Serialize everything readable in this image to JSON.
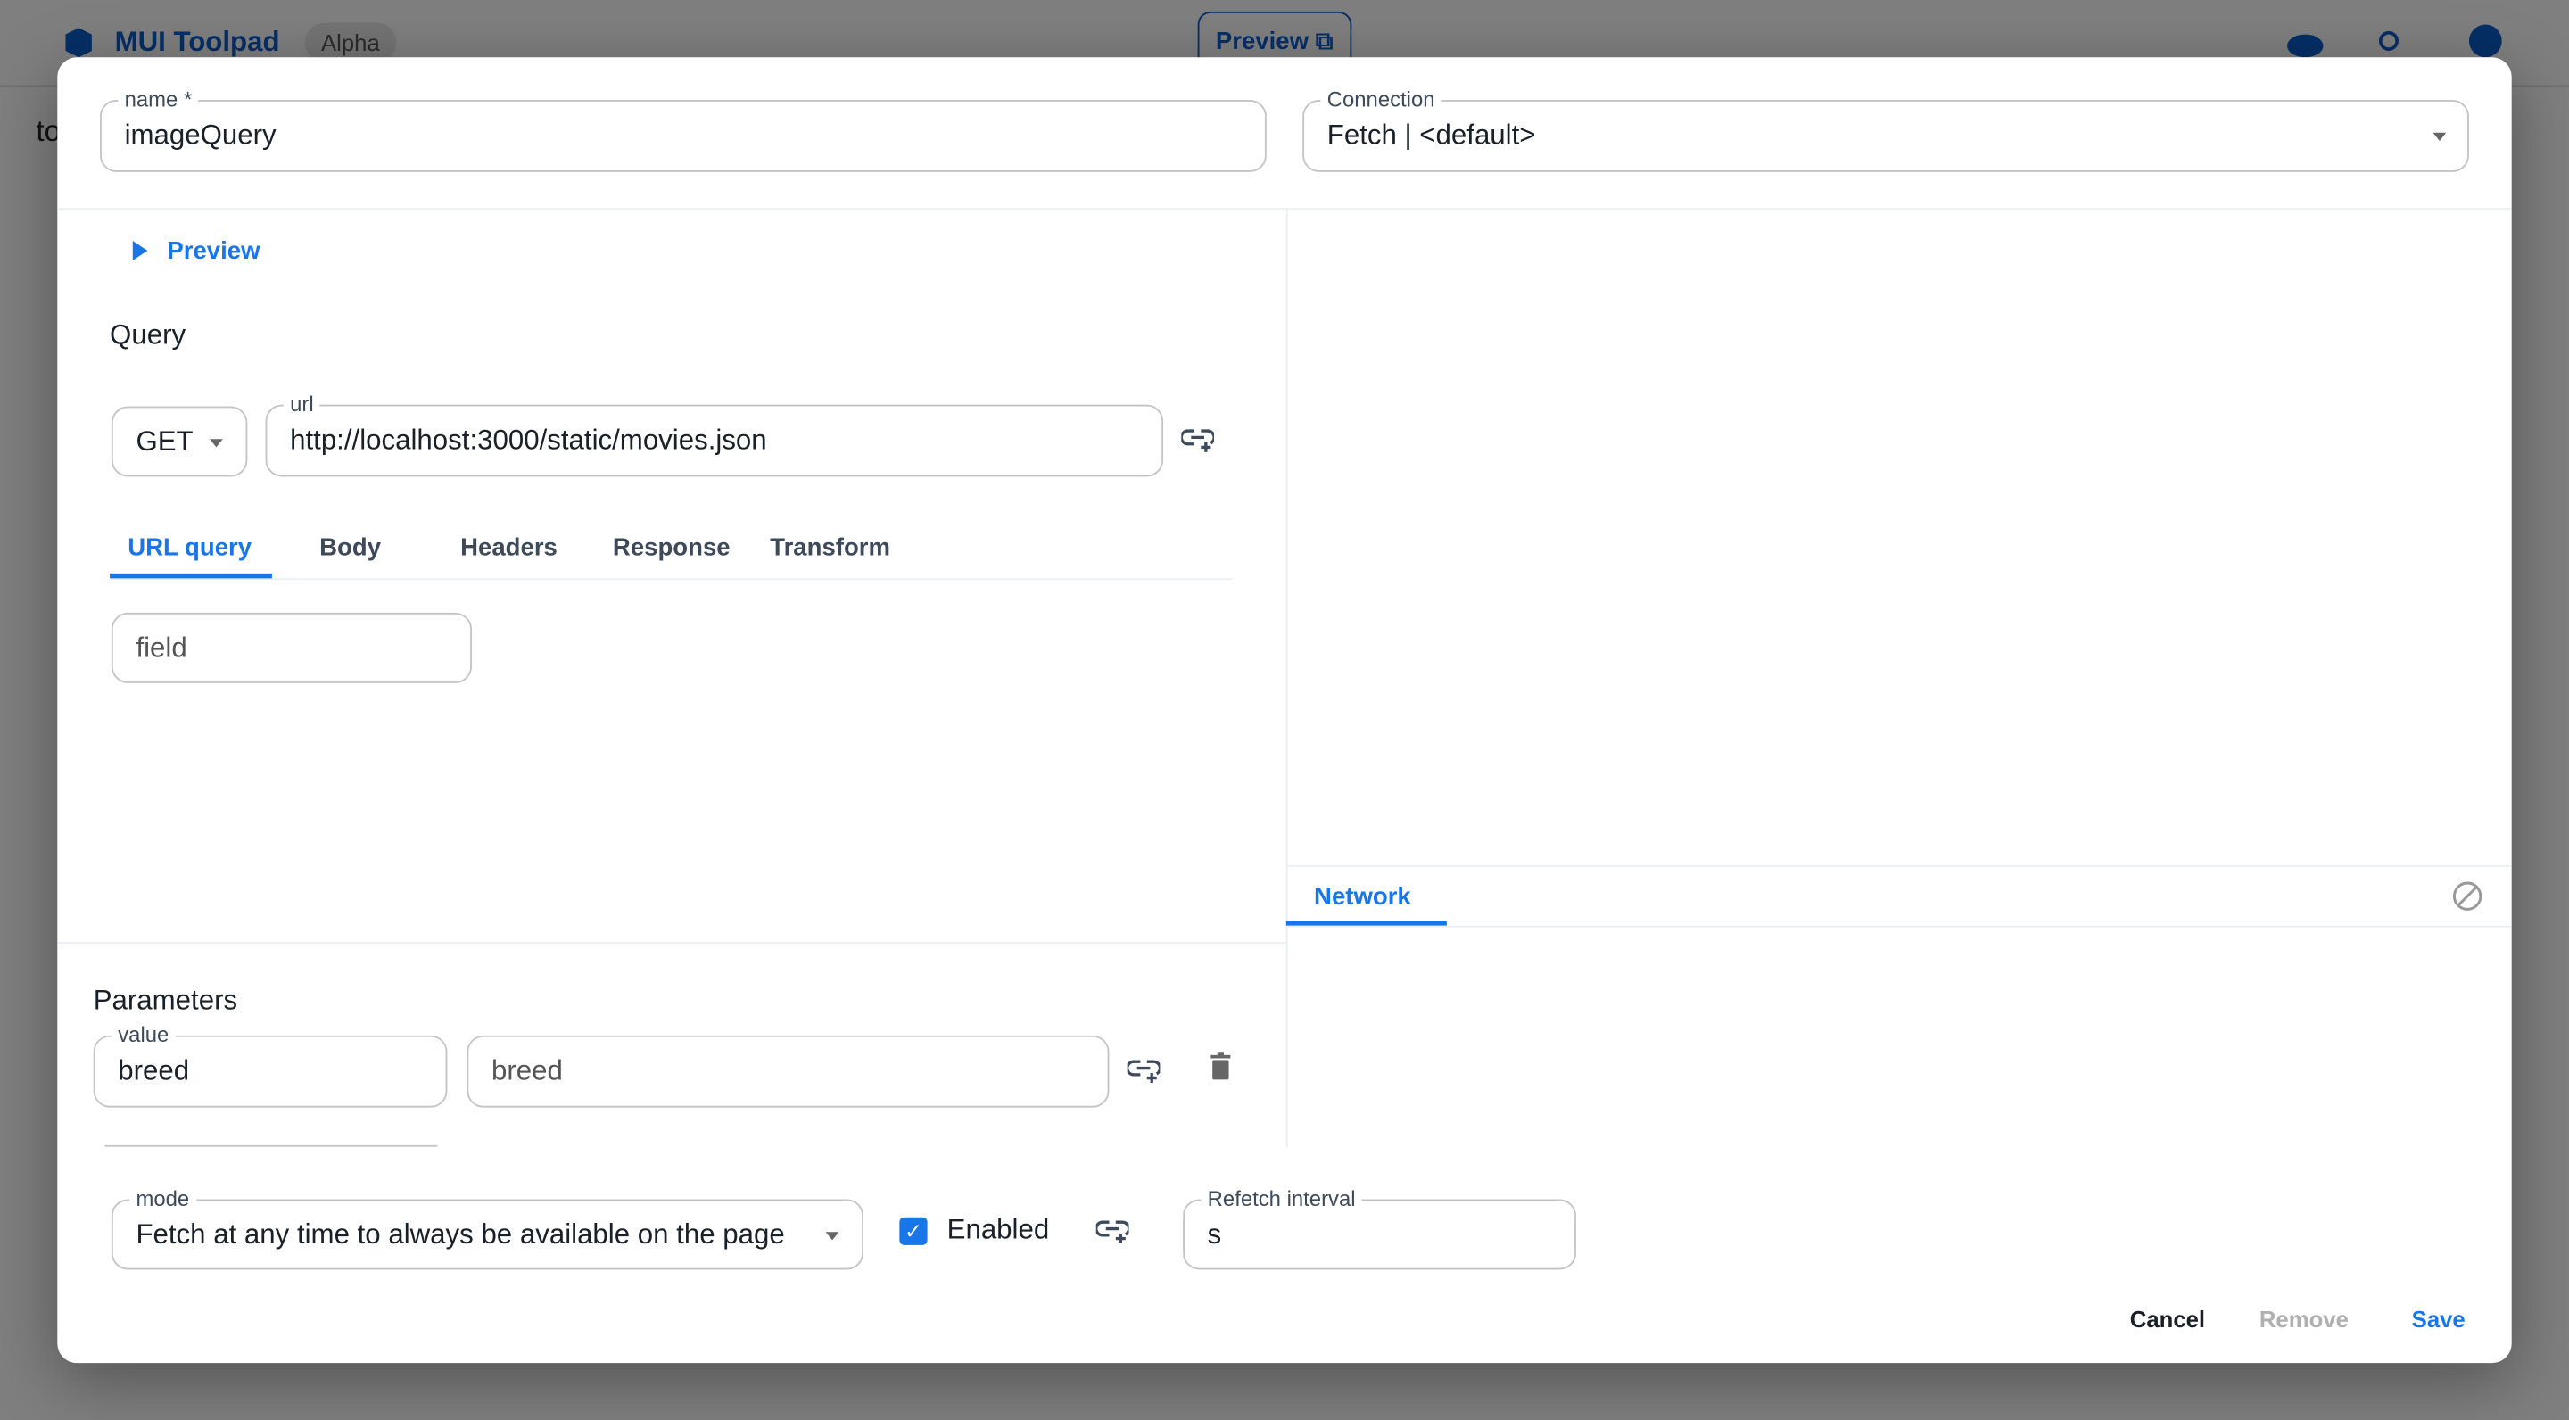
{
  "app": {
    "brand": "MUI Toolpad",
    "badge": "Alpha",
    "preview_button": "Preview",
    "page_fragment": "to"
  },
  "dialog": {
    "name_field": {
      "label": "name *",
      "value": "imageQuery"
    },
    "connection_field": {
      "label": "Connection",
      "value": "Fetch | <default>"
    },
    "preview_toggle": "Preview",
    "query_heading": "Query",
    "method_select": {
      "value": "GET"
    },
    "url_field": {
      "label": "url",
      "value": "http://localhost:3000/static/movies.json"
    },
    "tabs": [
      {
        "label": "URL query",
        "active": true
      },
      {
        "label": "Body"
      },
      {
        "label": "Headers"
      },
      {
        "label": "Response"
      },
      {
        "label": "Transform"
      }
    ],
    "url_query_field": {
      "placeholder": "field"
    },
    "parameters_heading": "Parameters",
    "parameter": {
      "name_label": "value",
      "name_value": "breed",
      "value_placeholder": "breed"
    },
    "network_tab": "Network",
    "mode_select": {
      "label": "mode",
      "value": "Fetch at any time to always be available on the page"
    },
    "enabled_checkbox": {
      "label": "Enabled",
      "checked": true
    },
    "refetch_field": {
      "label": "Refetch interval",
      "value": "s"
    },
    "actions": {
      "cancel": "Cancel",
      "remove": "Remove",
      "save": "Save"
    }
  },
  "colors": {
    "accent": "#1976e8",
    "brand": "#0b5fcc",
    "disabled": "#b0b0b0"
  }
}
